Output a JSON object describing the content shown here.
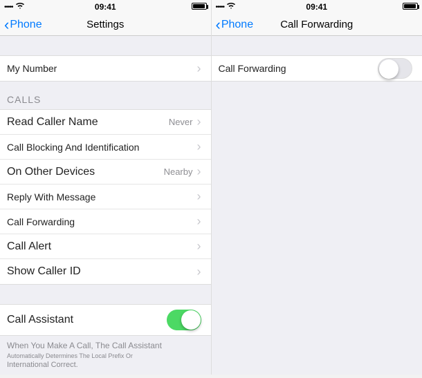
{
  "statusbar": {
    "dots": "•••••",
    "time": "09:41"
  },
  "left": {
    "back": "Phone",
    "title": "Settings",
    "myNumber": {
      "label": "My Number"
    },
    "callsHeader": "CALLS",
    "rows": {
      "readCaller": {
        "label": "Read Caller Name",
        "value": "Never"
      },
      "blocking": {
        "label": "Call Blocking And Identification"
      },
      "otherDevices": {
        "label": "On Other Devices",
        "value": "Nearby"
      },
      "replyMsg": {
        "label": "Reply With Message"
      },
      "forwarding": {
        "label": "Call Forwarding"
      },
      "alert": {
        "label": "Call Alert"
      },
      "callerId": {
        "label": "Show Caller ID"
      }
    },
    "assistant": {
      "label": "Call Assistant",
      "on": true
    },
    "footer": {
      "l1": "When You Make A Call, The Call Assistant",
      "l2": "Automatically Determines The Local Prefix Or",
      "l3": "International Correct."
    }
  },
  "right": {
    "back": "Phone",
    "title": "Call Forwarding",
    "row": {
      "label": "Call Forwarding",
      "on": false
    }
  }
}
